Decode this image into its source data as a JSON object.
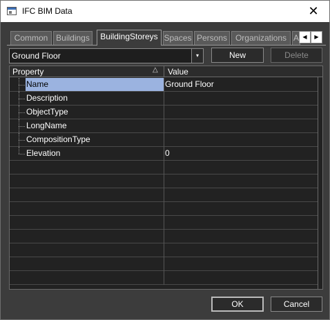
{
  "window": {
    "title": "IFC BIM Data",
    "close_glyph": "✕"
  },
  "tabs": [
    {
      "label": "Common",
      "active": false
    },
    {
      "label": "Buildings",
      "active": false
    },
    {
      "label": "BuildingStoreys",
      "active": true
    },
    {
      "label": "Spaces",
      "active": false
    },
    {
      "label": "Persons",
      "active": false
    },
    {
      "label": "Organizations",
      "active": false
    },
    {
      "label": "A",
      "active": false
    }
  ],
  "tab_scroll": {
    "left_glyph": "◀",
    "right_glyph": "▶"
  },
  "storey_select": {
    "value": "Ground Floor",
    "arrow_glyph": "▾"
  },
  "buttons": {
    "new": "New",
    "delete": "Delete",
    "ok": "OK",
    "cancel": "Cancel"
  },
  "grid": {
    "header": {
      "property": "Property",
      "value": "Value",
      "sort_glyph": "△"
    },
    "rows": [
      {
        "property": "Name",
        "value": "Ground Floor",
        "selected": true
      },
      {
        "property": "Description",
        "value": ""
      },
      {
        "property": "ObjectType",
        "value": ""
      },
      {
        "property": "LongName",
        "value": ""
      },
      {
        "property": "CompositionType",
        "value": ""
      },
      {
        "property": "Elevation",
        "value": "0"
      }
    ],
    "empty_row_count": 9
  },
  "icons": {
    "app": "app-window-icon",
    "close": "close-icon",
    "combo": "chevron-down-icon",
    "sort": "sort-ascending-icon"
  },
  "colors": {
    "background": "#3c3c3c",
    "grid": "#222222",
    "selection": "#9bb3e0",
    "titlebar": "#ffffff"
  }
}
